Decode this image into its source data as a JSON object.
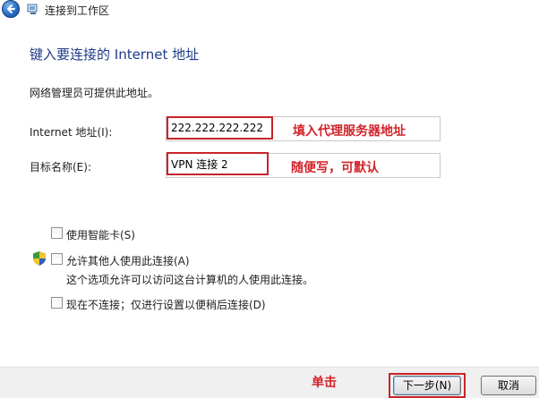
{
  "window": {
    "title": "连接到工作区"
  },
  "heading": "键入要连接的 Internet 地址",
  "admin_note": "网络管理员可提供此地址。",
  "fields": {
    "internet_address": {
      "label": "Internet 地址(I):",
      "value": "222.222.222.222"
    },
    "destination_name": {
      "label": "目标名称(E):",
      "value": "VPN 连接 2"
    }
  },
  "options": {
    "smart_card": {
      "label": "使用智能卡(S)",
      "checked": false
    },
    "allow_others": {
      "label": "允许其他人使用此连接(A)",
      "description": "这个选项允许可以访问这台计算机的人使用此连接。",
      "checked": false
    },
    "connect_later": {
      "label": "现在不连接；仅进行设置以便稍后连接(D)",
      "checked": false
    }
  },
  "annotations": {
    "proxy_hint": "填入代理服务器地址",
    "name_hint": "随便写，可默认",
    "click_hint": "单击"
  },
  "buttons": {
    "next": "下一步(N)",
    "cancel": "取消"
  },
  "colors": {
    "heading": "#1f3c88",
    "annotation": "#d1242b"
  },
  "icons": {
    "back": "back-arrow-icon",
    "wizard": "network-wizard-icon",
    "shield": "uac-shield-icon"
  }
}
